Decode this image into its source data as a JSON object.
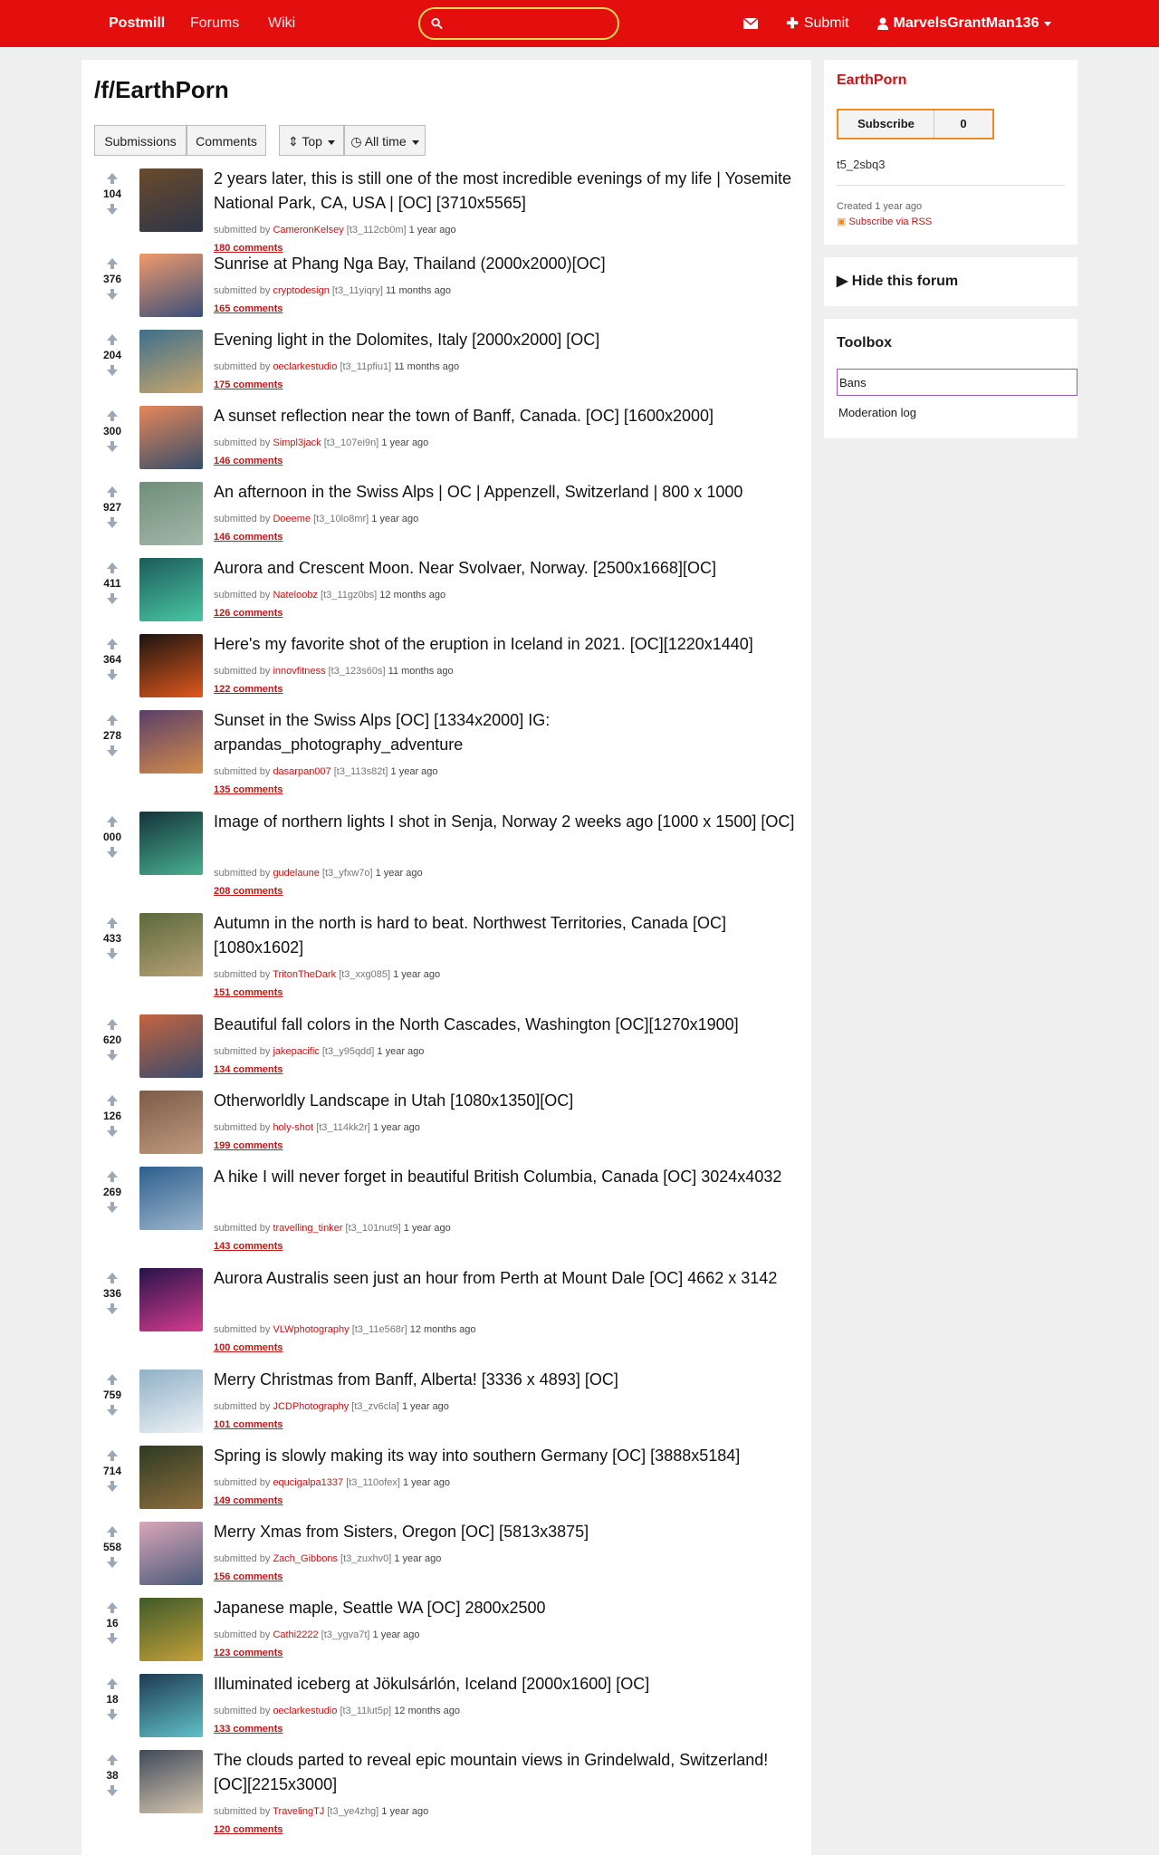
{
  "navbar": {
    "brand": "Postmill",
    "forums": "Forums",
    "wiki": "Wiki",
    "search_value": "",
    "submit": "Submit",
    "user": "MarvelsGrantMan136"
  },
  "forum": {
    "title": "/f/EarthPorn",
    "tabs": [
      "Submissions",
      "Comments"
    ],
    "sort": "Top",
    "time": "All time"
  },
  "posts": [
    {
      "title": "2 years later, this is still one of the most incredible evenings of my life | Yosemite National Park, CA, USA | [OC] [3710x5565]",
      "user": "CameronKelsey",
      "id": "[t3_112cb0m]",
      "age": "1 year ago",
      "comments": "180 comments",
      "score": "104"
    },
    {
      "title": "Sunrise at Phang Nga Bay, Thailand (2000x2000)[OC]",
      "user": "cryptodesign",
      "id": "[t3_11yiqry]",
      "age": "11 months ago",
      "comments": "165 comments",
      "score": "376"
    },
    {
      "title": "Evening light in the Dolomites, Italy [2000x2000] [OC]",
      "user": "oeclarkestudio",
      "id": "[t3_11pfiu1]",
      "age": "11 months ago",
      "comments": "175 comments",
      "score": "204"
    },
    {
      "title": "A sunset reflection near the town of Banff, Canada. [OC] [1600x2000]",
      "user": "Simpl3jack",
      "id": "[t3_107ei9n]",
      "age": "1 year ago",
      "comments": "146 comments",
      "score": "300"
    },
    {
      "title": "An afternoon in the Swiss Alps | OC | Appenzell, Switzerland | 800 x 1000",
      "user": "Doeeme",
      "id": "[t3_10lo8mr]",
      "age": "1 year ago",
      "comments": "146 comments",
      "score": "927"
    },
    {
      "title": "Aurora and Crescent Moon. Near Svolvaer, Norway. [2500x1668][OC]",
      "user": "Nateloobz",
      "id": "[t3_11gz0bs]",
      "age": "12 months ago",
      "comments": "126 comments",
      "score": "411"
    },
    {
      "title": "Here's my favorite shot of the eruption in Iceland in 2021. [OC][1220x1440]",
      "user": "innovfitness",
      "id": "[t3_123s60s]",
      "age": "11 months ago",
      "comments": "122 comments",
      "score": "364"
    },
    {
      "title": "Sunset in the Swiss Alps [OC] [1334x2000] IG: arpandas_photography_adventure",
      "user": "dasarpan007",
      "id": "[t3_113s82t]",
      "age": "1 year ago",
      "comments": "135 comments",
      "score": "278"
    },
    {
      "title": "Image of northern lights I shot in Senja, Norway 2 weeks ago [1000 x 1500] [OC]",
      "user": "gudelaune",
      "id": "[t3_yfxw7o]",
      "age": "1 year ago",
      "comments": "208 comments",
      "score": "000"
    },
    {
      "title": "Autumn in the north is hard to beat. Northwest Territories, Canada [OC] [1080x1602]",
      "user": "TritonTheDark",
      "id": "[t3_xxg085]",
      "age": "1 year ago",
      "comments": "151 comments",
      "score": "433"
    },
    {
      "title": "Beautiful fall colors in the North Cascades, Washington [OC][1270x1900]",
      "user": "jakepacific",
      "id": "[t3_y95qdd]",
      "age": "1 year ago",
      "comments": "134 comments",
      "score": "620"
    },
    {
      "title": "Otherworldly Landscape in Utah [1080x1350][OC]",
      "user": "holy-shot",
      "id": "[t3_114kk2r]",
      "age": "1 year ago",
      "comments": "199 comments",
      "score": "126"
    },
    {
      "title": "A hike I will never forget in beautiful British Columbia, Canada [OC] 3024x4032",
      "user": "travelling_tinker",
      "id": "[t3_101nut9]",
      "age": "1 year ago",
      "comments": "143 comments",
      "score": "269"
    },
    {
      "title": "Aurora Australis seen just an hour from Perth at Mount Dale [OC] 4662 x 3142",
      "user": "VLWphotography",
      "id": "[t3_11e568r]",
      "age": "12 months ago",
      "comments": "100 comments",
      "score": "336"
    },
    {
      "title": "Merry Christmas from Banff, Alberta! [3336 x 4893] [OC]",
      "user": "JCDPhotography",
      "id": "[t3_zv6cla]",
      "age": "1 year ago",
      "comments": "101 comments",
      "score": "759"
    },
    {
      "title": "Spring is slowly making its way into southern Germany [OC] [3888x5184]",
      "user": "equcigalpa1337",
      "id": "[t3_110ofex]",
      "age": "1 year ago",
      "comments": "149 comments",
      "score": "714"
    },
    {
      "title": "Merry Xmas from Sisters, Oregon [OC] [5813x3875]",
      "user": "Zach_Gibbons",
      "id": "[t3_zuxhv0]",
      "age": "1 year ago",
      "comments": "156 comments",
      "score": "558"
    },
    {
      "title": "Japanese maple, Seattle WA [OC] 2800x2500",
      "user": "Cathi2222",
      "id": "[t3_ygva7t]",
      "age": "1 year ago",
      "comments": "123 comments",
      "score": "16"
    },
    {
      "title": "Illuminated iceberg at Jökulsárlón, Iceland [2000x1600] [OC]",
      "user": "oeclarkestudio",
      "id": "[t3_11lut5p]",
      "age": "12 months ago",
      "comments": "133 comments",
      "score": "18"
    },
    {
      "title": "The clouds parted to reveal epic mountain views in Grindelwald, Switzerland! [OC][2215x3000]",
      "user": "TravelingTJ",
      "id": "[t3_ye4zhg]",
      "age": "1 year ago",
      "comments": "120 comments",
      "score": "38"
    }
  ],
  "sidebar": {
    "forum_name": "EarthPorn",
    "subscribe": "Subscribe",
    "subscribers": "0",
    "forum_id": "t5_2sbq3",
    "created": "Created 1 year ago",
    "rss": "Subscribe via RSS",
    "hide": "Hide this forum",
    "toolbox_title": "Toolbox",
    "toolbox_items": [
      "Bans",
      "Moderation log"
    ]
  },
  "labels": {
    "submitted_by": "submitted by"
  }
}
